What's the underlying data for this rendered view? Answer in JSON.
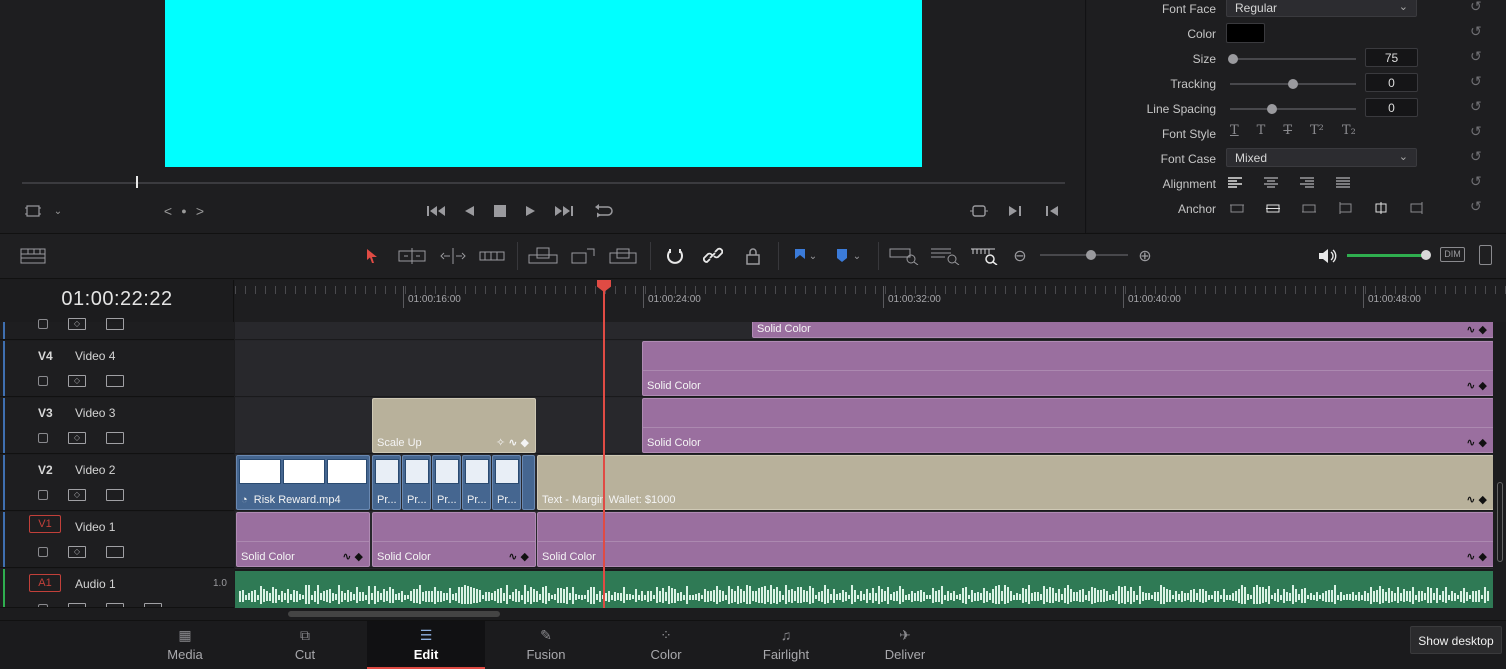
{
  "viewer": {
    "nav_prev": "<",
    "nav_dot": "●",
    "nav_next": ">"
  },
  "inspector": {
    "font_face_label": "Font Face",
    "font_face_value": "Regular",
    "color_label": "Color",
    "color_value": "#000000",
    "size_label": "Size",
    "size_value": "75",
    "size_fraction": 0.0,
    "tracking_label": "Tracking",
    "tracking_value": "0",
    "tracking_fraction": 0.5,
    "line_spacing_label": "Line Spacing",
    "line_spacing_value": "0",
    "line_spacing_fraction": 0.33,
    "font_style_label": "Font Style",
    "font_style_glyphs": [
      "T",
      "T",
      "T",
      "T²",
      "T₂"
    ],
    "font_case_label": "Font Case",
    "font_case_value": "Mixed",
    "alignment_label": "Alignment",
    "anchor_label": "Anchor"
  },
  "timeline": {
    "timecode": "01:00:22:22",
    "ruler_labels": [
      "01:00:16:00",
      "01:00:24:00",
      "01:00:32:00",
      "01:00:40:00",
      "01:00:48:00"
    ],
    "tracks": [
      {
        "id": "V4",
        "name": "Video 4"
      },
      {
        "id": "V3",
        "name": "Video 3"
      },
      {
        "id": "V2",
        "name": "Video 2"
      },
      {
        "id": "V1",
        "name": "Video 1"
      },
      {
        "id": "A1",
        "name": "Audio 1",
        "level": "1.0"
      }
    ],
    "clips": {
      "top_solid": "Solid Color",
      "v4_solid": "Solid Color",
      "v3_scale_up": "Scale Up",
      "v3_solid": "Solid Color",
      "v2_risk": "Risk Reward.mp4",
      "v2_pr": [
        "Pr...",
        "Pr...",
        "Pr...",
        "Pr...",
        "Pr..."
      ],
      "v2_text": "Text - Margin Wallet: $1000",
      "v1_solid_a": "Solid Color",
      "v1_solid_b": "Solid Color",
      "v1_solid_c": "Solid Color"
    },
    "colors": {
      "solid_clip": "#9a6f9f",
      "title_clip": "#b8b19b",
      "video_clip": "#456690",
      "audio_clip": "#2f7a55",
      "playhead": "#e04b44"
    }
  },
  "pages": [
    {
      "label": "Media",
      "icon": "media-icon"
    },
    {
      "label": "Cut",
      "icon": "cut-icon"
    },
    {
      "label": "Edit",
      "icon": "edit-icon",
      "active": true
    },
    {
      "label": "Fusion",
      "icon": "fusion-icon"
    },
    {
      "label": "Color",
      "icon": "color-icon"
    },
    {
      "label": "Fairlight",
      "icon": "fairlight-icon"
    },
    {
      "label": "Deliver",
      "icon": "deliver-icon"
    }
  ],
  "show_desktop": "Show desktop"
}
